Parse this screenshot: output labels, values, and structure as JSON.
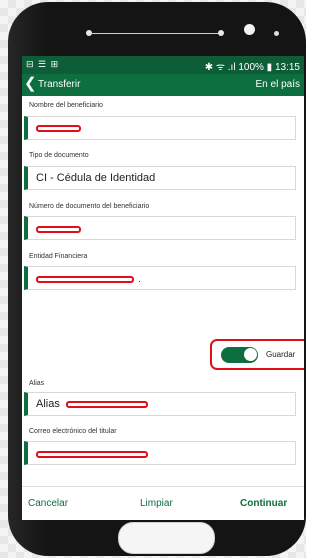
{
  "status_bar": {
    "left_icons": "⊟ ☰ ⊞",
    "right_text": "✱ ᯤ .ıl 100% ▮ 13:15"
  },
  "app_bar": {
    "back_glyph": "❮",
    "title": "Transferir",
    "right_label": "En el país"
  },
  "form": {
    "beneficiary_name_label": "Nombre del beneficiario",
    "doc_type_label": "Tipo de documento",
    "doc_type_value": "CI - Cédula de Identidad",
    "doc_number_label": "Número de documento del beneficiario",
    "bank_label": "Entidad Financiera",
    "bank_trailing_text": ".",
    "save_toggle_label": "Guardar",
    "save_toggle_on": true,
    "alias_label": "Alias",
    "alias_prefix": "Alias",
    "email_label": "Correo electrónico del titular"
  },
  "buttons": {
    "cancel": "Cancelar",
    "clear": "Limpiar",
    "continue": "Continuar"
  },
  "colors": {
    "accent": "#0d6e40",
    "status_bar": "#0d5e38",
    "highlight": "#e01017"
  }
}
